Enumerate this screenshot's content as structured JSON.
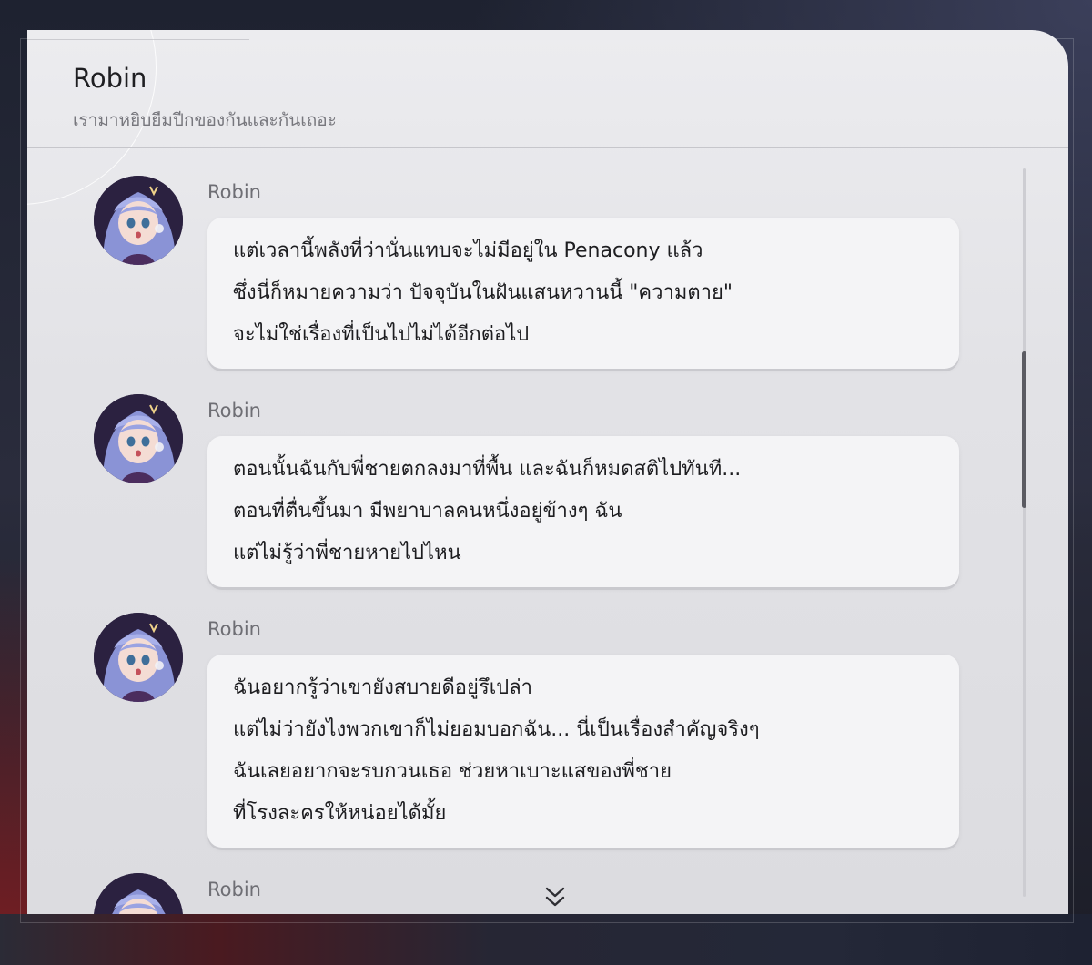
{
  "header": {
    "title": "Robin",
    "subtitle": "เรามาหยิบยืมปีกของกันและกันเถอะ"
  },
  "messages": [
    {
      "sender": "Robin",
      "lines": [
        "แต่เวลานี้พลังที่ว่านั่นแทบจะไม่มีอยู่ใน Penacony แล้ว",
        "ซึ่งนี่ก็หมายความว่า ปัจจุบันในฝันแสนหวานนี้ \"ความตาย\"",
        "จะไม่ใช่เรื่องที่เป็นไปไม่ได้อีกต่อไป"
      ]
    },
    {
      "sender": "Robin",
      "lines": [
        "ตอนนั้นฉันกับพี่ชายตกลงมาที่พื้น และฉันก็หมดสติไปทันที...",
        "ตอนที่ตื่นขึ้นมา มีพยาบาลคนหนึ่งอยู่ข้างๆ ฉัน",
        "แต่ไม่รู้ว่าพี่ชายหายไปไหน"
      ]
    },
    {
      "sender": "Robin",
      "lines": [
        "ฉันอยากรู้ว่าเขายังสบายดีอยู่รึเปล่า",
        "แต่ไม่ว่ายังไงพวกเขาก็ไม่ยอมบอกฉัน... นี่เป็นเรื่องสำคัญจริงๆ",
        "ฉันเลยอยากจะรบกวนเธอ ช่วยหาเบาะแสของพี่ชาย",
        "ที่โรงละครให้หน่อยได้มั้ย"
      ]
    },
    {
      "sender": "Robin",
      "lines": []
    }
  ],
  "scroll": {
    "position_fraction": 0.35,
    "more_icon": "double-chevron-down-icon"
  },
  "colors": {
    "panel_bg": "#e6e6e9",
    "bubble_bg": "#f4f4f6",
    "text": "#1d1d20",
    "muted_text": "#6e6e74",
    "scroll_thumb": "#5b5b62"
  }
}
